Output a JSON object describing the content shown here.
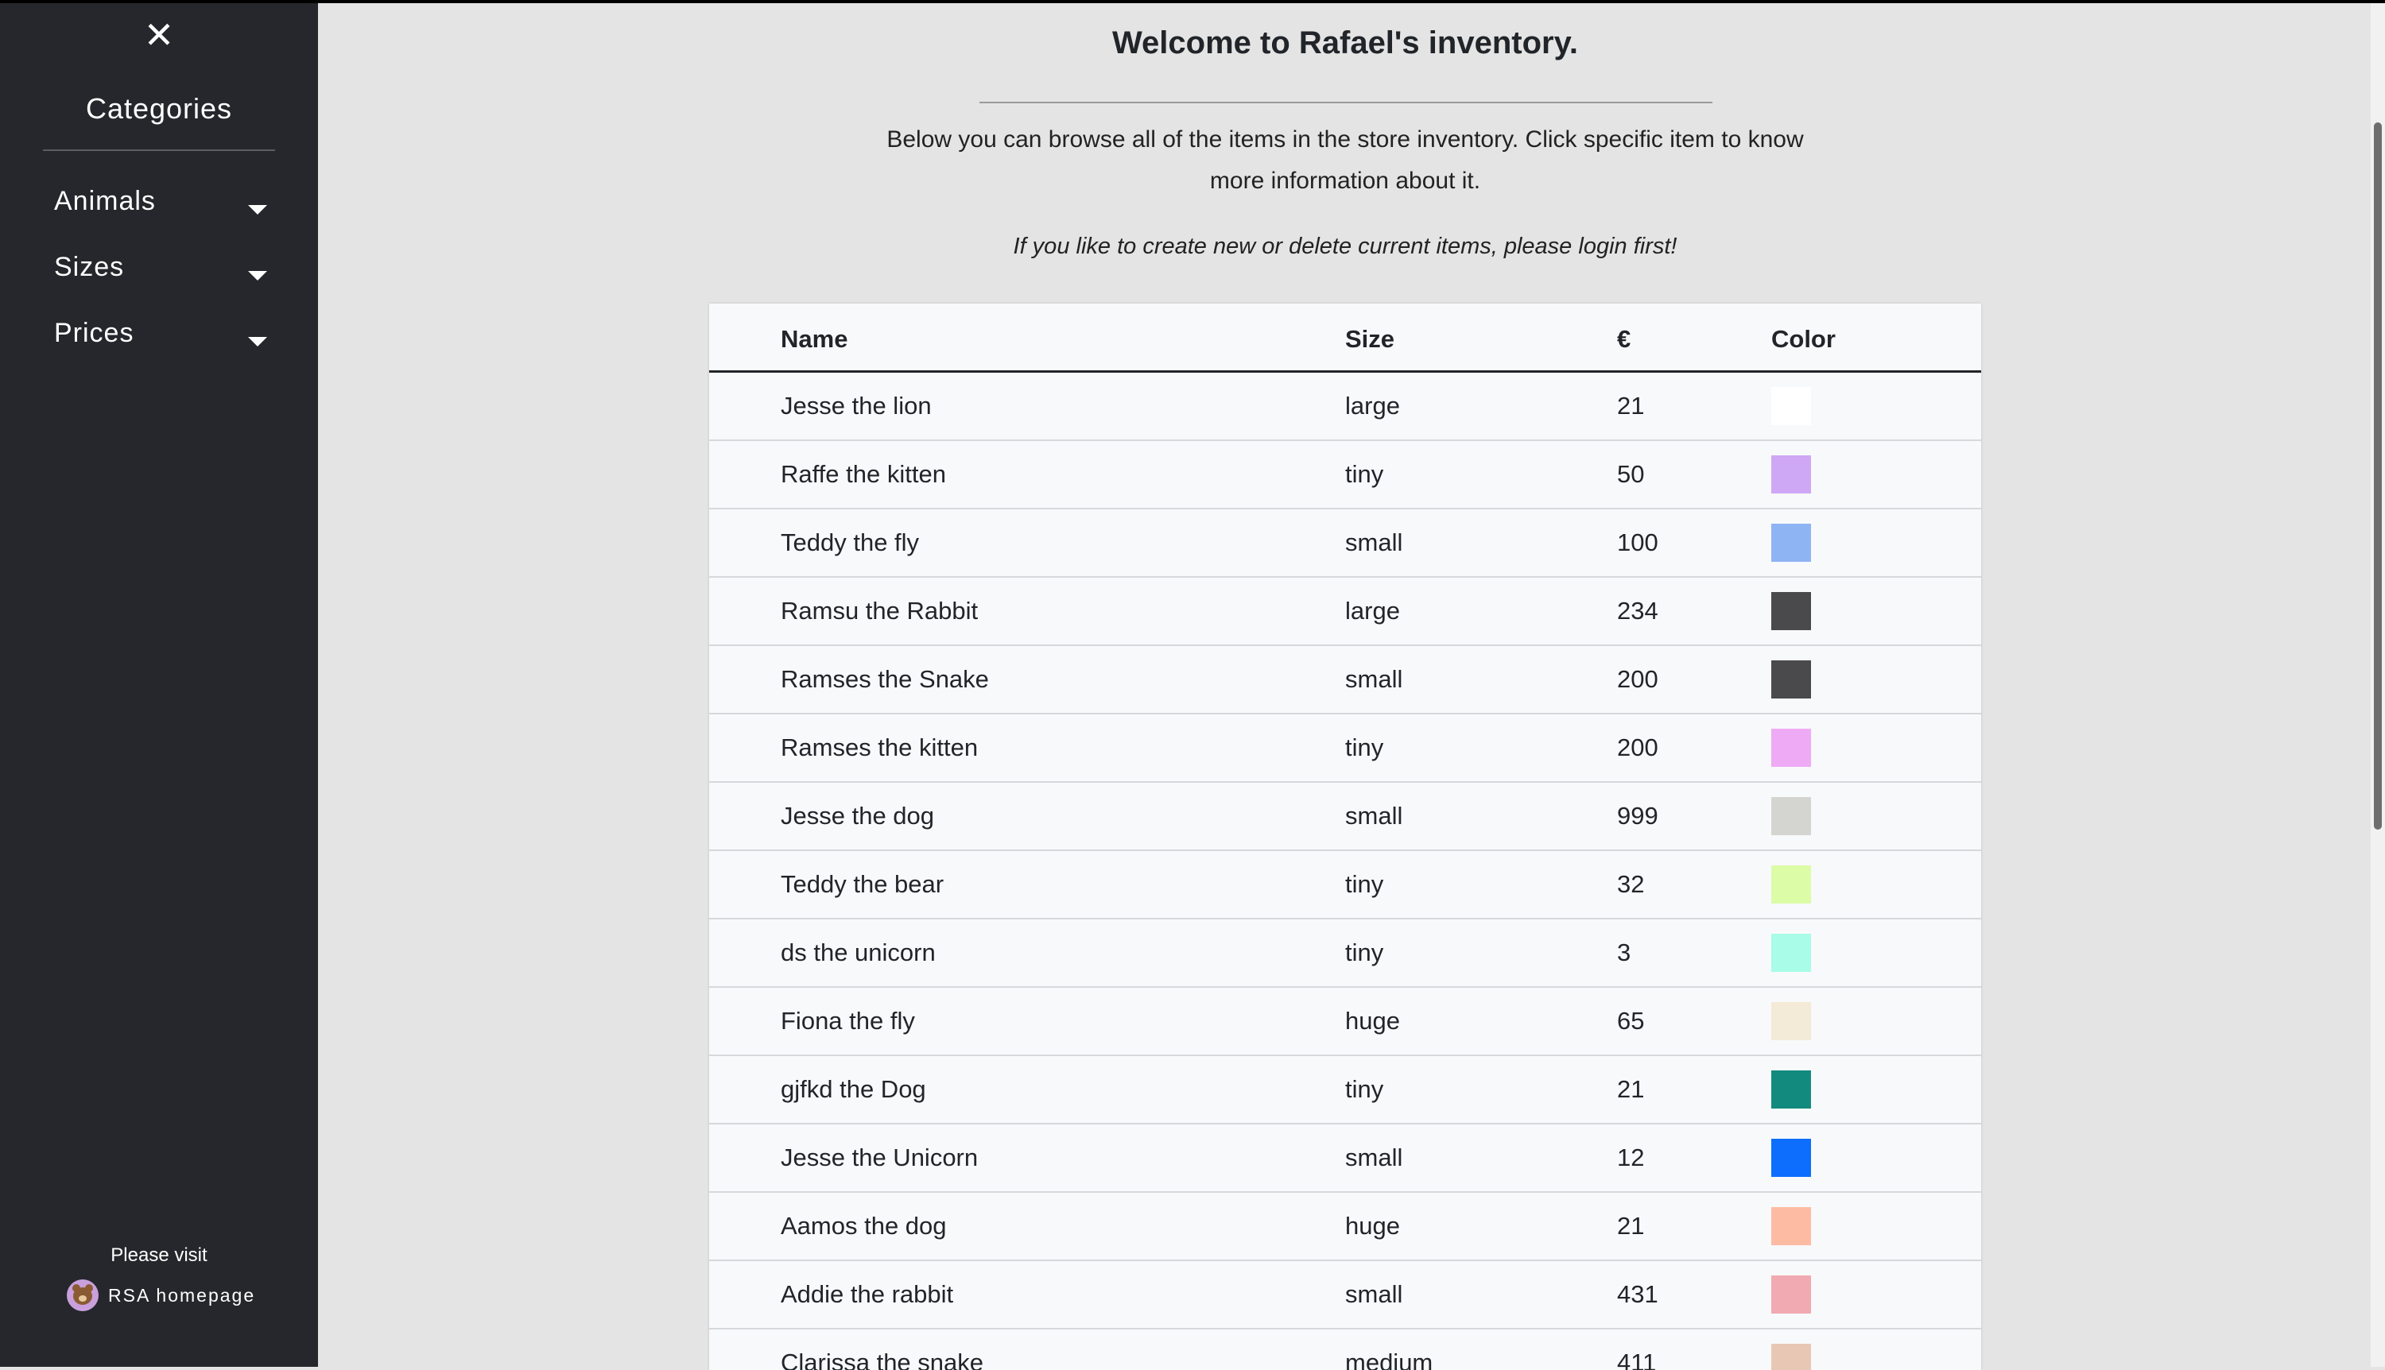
{
  "sidebar": {
    "close_label": "✕",
    "categories_title": "Categories",
    "items": [
      {
        "label": "Animals"
      },
      {
        "label": "Sizes"
      },
      {
        "label": "Prices"
      }
    ],
    "visit_text": "Please visit",
    "home_link": "RSA homepage"
  },
  "main": {
    "title": "Welcome to Rafael's inventory.",
    "intro": "Below you can browse all of the items in the store inventory. Click specific item to know more information about it.",
    "login_note": "If you like to create new or delete current items, please login first!"
  },
  "table": {
    "headers": {
      "name": "Name",
      "size": "Size",
      "price": "€",
      "color": "Color"
    },
    "rows": [
      {
        "name": "Jesse the lion",
        "size": "large",
        "price": "21",
        "color": "#ffffff"
      },
      {
        "name": "Raffe the kitten",
        "size": "tiny",
        "price": "50",
        "color": "#cfa8f5"
      },
      {
        "name": "Teddy the fly",
        "size": "small",
        "price": "100",
        "color": "#8fb4f4"
      },
      {
        "name": "Ramsu the Rabbit",
        "size": "large",
        "price": "234",
        "color": "#4a4a4c"
      },
      {
        "name": "Ramses the Snake",
        "size": "small",
        "price": "200",
        "color": "#4a4a4c"
      },
      {
        "name": "Ramses the kitten",
        "size": "tiny",
        "price": "200",
        "color": "#eeaaf5"
      },
      {
        "name": "Jesse the dog",
        "size": "small",
        "price": "999",
        "color": "#d4d4d0"
      },
      {
        "name": "Teddy the bear",
        "size": "tiny",
        "price": "32",
        "color": "#dcfca8"
      },
      {
        "name": "ds the unicorn",
        "size": "tiny",
        "price": "3",
        "color": "#a8fce8"
      },
      {
        "name": "Fiona the fly",
        "size": "huge",
        "price": "65",
        "color": "#f4ead8"
      },
      {
        "name": "gjfkd the Dog",
        "size": "tiny",
        "price": "21",
        "color": "#138a7e"
      },
      {
        "name": "Jesse the Unicorn",
        "size": "small",
        "price": "12",
        "color": "#0d6efd"
      },
      {
        "name": "Aamos the dog",
        "size": "huge",
        "price": "21",
        "color": "#fdbba4"
      },
      {
        "name": "Addie the rabbit",
        "size": "small",
        "price": "431",
        "color": "#f1aab1"
      },
      {
        "name": "Clarissa the snake",
        "size": "medium",
        "price": "411",
        "color": "#e8c8b4"
      }
    ]
  }
}
